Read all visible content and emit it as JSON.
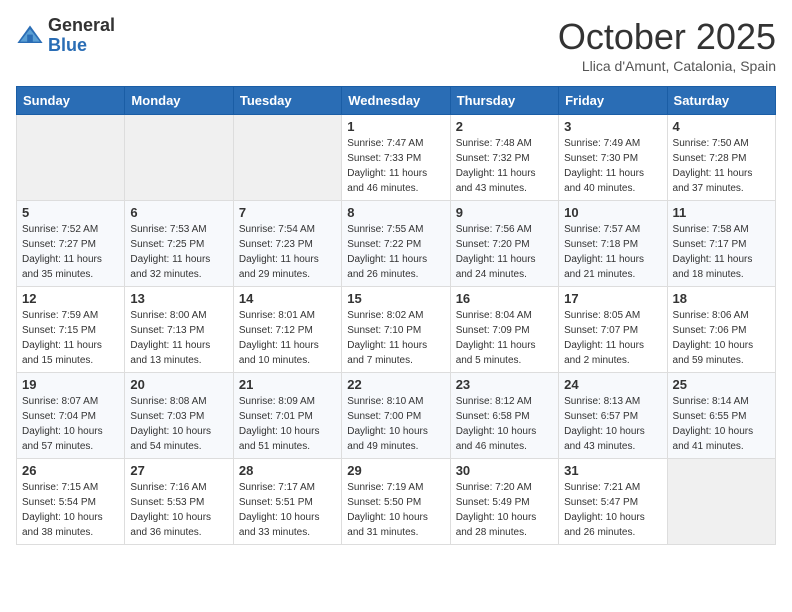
{
  "header": {
    "logo_general": "General",
    "logo_blue": "Blue",
    "title": "October 2025",
    "location": "Llica d'Amunt, Catalonia, Spain"
  },
  "weekdays": [
    "Sunday",
    "Monday",
    "Tuesday",
    "Wednesday",
    "Thursday",
    "Friday",
    "Saturday"
  ],
  "weeks": [
    [
      {
        "day": "",
        "sunrise": "",
        "sunset": "",
        "daylight": ""
      },
      {
        "day": "",
        "sunrise": "",
        "sunset": "",
        "daylight": ""
      },
      {
        "day": "",
        "sunrise": "",
        "sunset": "",
        "daylight": ""
      },
      {
        "day": "1",
        "sunrise": "Sunrise: 7:47 AM",
        "sunset": "Sunset: 7:33 PM",
        "daylight": "Daylight: 11 hours and 46 minutes."
      },
      {
        "day": "2",
        "sunrise": "Sunrise: 7:48 AM",
        "sunset": "Sunset: 7:32 PM",
        "daylight": "Daylight: 11 hours and 43 minutes."
      },
      {
        "day": "3",
        "sunrise": "Sunrise: 7:49 AM",
        "sunset": "Sunset: 7:30 PM",
        "daylight": "Daylight: 11 hours and 40 minutes."
      },
      {
        "day": "4",
        "sunrise": "Sunrise: 7:50 AM",
        "sunset": "Sunset: 7:28 PM",
        "daylight": "Daylight: 11 hours and 37 minutes."
      }
    ],
    [
      {
        "day": "5",
        "sunrise": "Sunrise: 7:52 AM",
        "sunset": "Sunset: 7:27 PM",
        "daylight": "Daylight: 11 hours and 35 minutes."
      },
      {
        "day": "6",
        "sunrise": "Sunrise: 7:53 AM",
        "sunset": "Sunset: 7:25 PM",
        "daylight": "Daylight: 11 hours and 32 minutes."
      },
      {
        "day": "7",
        "sunrise": "Sunrise: 7:54 AM",
        "sunset": "Sunset: 7:23 PM",
        "daylight": "Daylight: 11 hours and 29 minutes."
      },
      {
        "day": "8",
        "sunrise": "Sunrise: 7:55 AM",
        "sunset": "Sunset: 7:22 PM",
        "daylight": "Daylight: 11 hours and 26 minutes."
      },
      {
        "day": "9",
        "sunrise": "Sunrise: 7:56 AM",
        "sunset": "Sunset: 7:20 PM",
        "daylight": "Daylight: 11 hours and 24 minutes."
      },
      {
        "day": "10",
        "sunrise": "Sunrise: 7:57 AM",
        "sunset": "Sunset: 7:18 PM",
        "daylight": "Daylight: 11 hours and 21 minutes."
      },
      {
        "day": "11",
        "sunrise": "Sunrise: 7:58 AM",
        "sunset": "Sunset: 7:17 PM",
        "daylight": "Daylight: 11 hours and 18 minutes."
      }
    ],
    [
      {
        "day": "12",
        "sunrise": "Sunrise: 7:59 AM",
        "sunset": "Sunset: 7:15 PM",
        "daylight": "Daylight: 11 hours and 15 minutes."
      },
      {
        "day": "13",
        "sunrise": "Sunrise: 8:00 AM",
        "sunset": "Sunset: 7:13 PM",
        "daylight": "Daylight: 11 hours and 13 minutes."
      },
      {
        "day": "14",
        "sunrise": "Sunrise: 8:01 AM",
        "sunset": "Sunset: 7:12 PM",
        "daylight": "Daylight: 11 hours and 10 minutes."
      },
      {
        "day": "15",
        "sunrise": "Sunrise: 8:02 AM",
        "sunset": "Sunset: 7:10 PM",
        "daylight": "Daylight: 11 hours and 7 minutes."
      },
      {
        "day": "16",
        "sunrise": "Sunrise: 8:04 AM",
        "sunset": "Sunset: 7:09 PM",
        "daylight": "Daylight: 11 hours and 5 minutes."
      },
      {
        "day": "17",
        "sunrise": "Sunrise: 8:05 AM",
        "sunset": "Sunset: 7:07 PM",
        "daylight": "Daylight: 11 hours and 2 minutes."
      },
      {
        "day": "18",
        "sunrise": "Sunrise: 8:06 AM",
        "sunset": "Sunset: 7:06 PM",
        "daylight": "Daylight: 10 hours and 59 minutes."
      }
    ],
    [
      {
        "day": "19",
        "sunrise": "Sunrise: 8:07 AM",
        "sunset": "Sunset: 7:04 PM",
        "daylight": "Daylight: 10 hours and 57 minutes."
      },
      {
        "day": "20",
        "sunrise": "Sunrise: 8:08 AM",
        "sunset": "Sunset: 7:03 PM",
        "daylight": "Daylight: 10 hours and 54 minutes."
      },
      {
        "day": "21",
        "sunrise": "Sunrise: 8:09 AM",
        "sunset": "Sunset: 7:01 PM",
        "daylight": "Daylight: 10 hours and 51 minutes."
      },
      {
        "day": "22",
        "sunrise": "Sunrise: 8:10 AM",
        "sunset": "Sunset: 7:00 PM",
        "daylight": "Daylight: 10 hours and 49 minutes."
      },
      {
        "day": "23",
        "sunrise": "Sunrise: 8:12 AM",
        "sunset": "Sunset: 6:58 PM",
        "daylight": "Daylight: 10 hours and 46 minutes."
      },
      {
        "day": "24",
        "sunrise": "Sunrise: 8:13 AM",
        "sunset": "Sunset: 6:57 PM",
        "daylight": "Daylight: 10 hours and 43 minutes."
      },
      {
        "day": "25",
        "sunrise": "Sunrise: 8:14 AM",
        "sunset": "Sunset: 6:55 PM",
        "daylight": "Daylight: 10 hours and 41 minutes."
      }
    ],
    [
      {
        "day": "26",
        "sunrise": "Sunrise: 7:15 AM",
        "sunset": "Sunset: 5:54 PM",
        "daylight": "Daylight: 10 hours and 38 minutes."
      },
      {
        "day": "27",
        "sunrise": "Sunrise: 7:16 AM",
        "sunset": "Sunset: 5:53 PM",
        "daylight": "Daylight: 10 hours and 36 minutes."
      },
      {
        "day": "28",
        "sunrise": "Sunrise: 7:17 AM",
        "sunset": "Sunset: 5:51 PM",
        "daylight": "Daylight: 10 hours and 33 minutes."
      },
      {
        "day": "29",
        "sunrise": "Sunrise: 7:19 AM",
        "sunset": "Sunset: 5:50 PM",
        "daylight": "Daylight: 10 hours and 31 minutes."
      },
      {
        "day": "30",
        "sunrise": "Sunrise: 7:20 AM",
        "sunset": "Sunset: 5:49 PM",
        "daylight": "Daylight: 10 hours and 28 minutes."
      },
      {
        "day": "31",
        "sunrise": "Sunrise: 7:21 AM",
        "sunset": "Sunset: 5:47 PM",
        "daylight": "Daylight: 10 hours and 26 minutes."
      },
      {
        "day": "",
        "sunrise": "",
        "sunset": "",
        "daylight": ""
      }
    ]
  ]
}
